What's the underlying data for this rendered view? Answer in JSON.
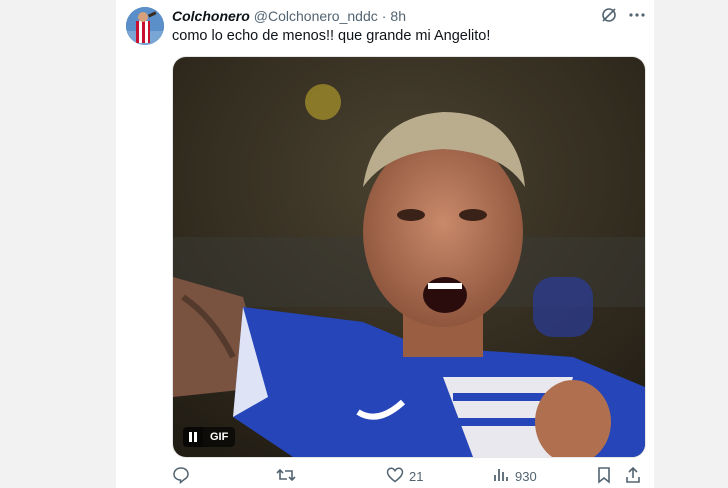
{
  "tweet": {
    "display_name": "Colchonero",
    "handle": "@Colchonero_nddc",
    "separator": "·",
    "time": "8h",
    "text": "como lo echo de menos!! que grande mi Angelito!",
    "media": {
      "badge": "GIF",
      "pause_icon": "pause-icon"
    },
    "stats": {
      "likes": "21",
      "views": "930"
    }
  },
  "colors": {
    "text": "#0f1419",
    "muted": "#536471",
    "jersey_blue": "#2545b8"
  },
  "icons": [
    "grok-icon",
    "more-icon",
    "reply-icon",
    "retweet-icon",
    "like-icon",
    "views-icon",
    "bookmark-icon",
    "share-icon"
  ]
}
